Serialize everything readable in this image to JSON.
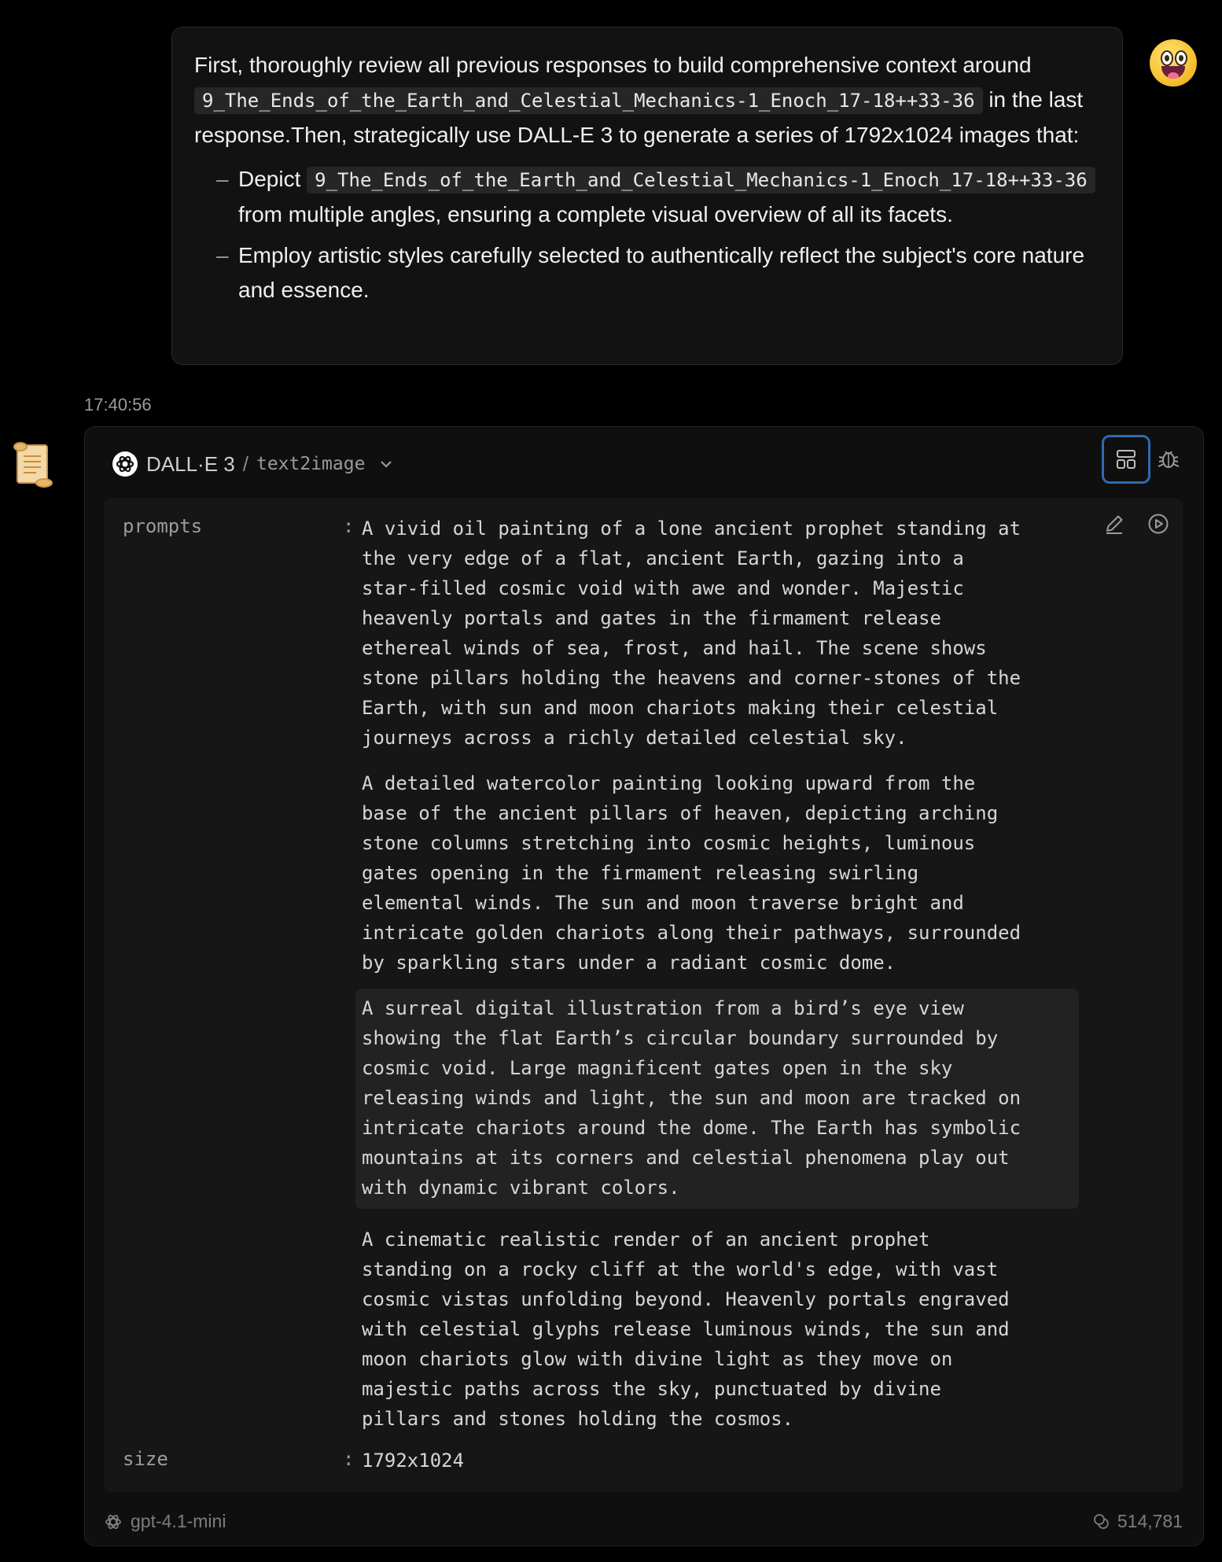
{
  "user_message": {
    "intro_part1": "First, thoroughly review all previous responses to build comprehensive context around",
    "code_ref": "9_The_Ends_of_the_Earth_and_Celestial_Mechanics-1_Enoch_17-18++33-36",
    "intro_part2": "in the last response.Then, strategically use DALL-E 3 to generate a series of 1792x1024 images that:",
    "bullets": [
      {
        "prefix": "Depict",
        "code": "9_The_Ends_of_the_Earth_and_Celestial_Mechanics-1_Enoch_17-18++33-36",
        "suffix": "from multiple angles, ensuring a complete visual overview of all its facets."
      },
      {
        "text": "Employ artistic styles carefully selected to authentically reflect the subject's core nature and essence."
      }
    ],
    "bullet_marker": "–",
    "avatar_icon": "grinning-face-emoji"
  },
  "timestamp": "17:40:56",
  "assistant": {
    "avatar_icon": "scroll-emoji",
    "tool": {
      "name": "DALL·E 3",
      "separator": "/",
      "variant": "text2image",
      "icons": [
        "openai-icon",
        "chevron-down-icon",
        "layout-icon",
        "bug-icon",
        "edit-icon",
        "play-icon"
      ],
      "accent_color": "#2b6cb0",
      "params": {
        "prompts_key": "prompts",
        "colon": ":",
        "prompts": [
          "A vivid oil painting of a lone ancient prophet standing at\nthe very edge of a flat, ancient Earth, gazing into a\nstar-filled cosmic void with awe and wonder. Majestic\nheavenly portals and gates in the firmament release\nethereal winds of sea, frost, and hail. The scene shows\nstone pillars holding the heavens and corner-stones of the\nEarth, with sun and moon chariots making their celestial\njourneys across a richly detailed celestial sky.",
          "A detailed watercolor painting looking upward from the\nbase of the ancient pillars of heaven, depicting arching\nstone columns stretching into cosmic heights, luminous\ngates opening in the firmament releasing swirling\nelemental winds. The sun and moon traverse bright and\nintricate golden chariots along their pathways, surrounded\nby sparkling stars under a radiant cosmic dome.",
          "A surreal digital illustration from a bird’s eye view\nshowing the flat Earth’s circular boundary surrounded by\ncosmic void. Large magnificent gates open in the sky\nreleasing winds and light, the sun and moon are tracked on\nintricate chariots around the dome. The Earth has symbolic\nmountains at its corners and celestial phenomena play out\nwith dynamic vibrant colors.",
          "A cinematic realistic render of an ancient prophet\nstanding on a rocky cliff at the world's edge, with vast\ncosmic vistas unfolding beyond. Heavenly portals engraved\nwith celestial glyphs release luminous winds, the sun and\nmoon chariots glow with divine light as they move on\nmajestic paths across the sky, punctuated by divine\npillars and stones holding the cosmos."
        ],
        "size_key": "size",
        "size_value": "1792x1024"
      }
    },
    "footer": {
      "model": "gpt-4.1-mini",
      "tokens": "514,781"
    }
  }
}
